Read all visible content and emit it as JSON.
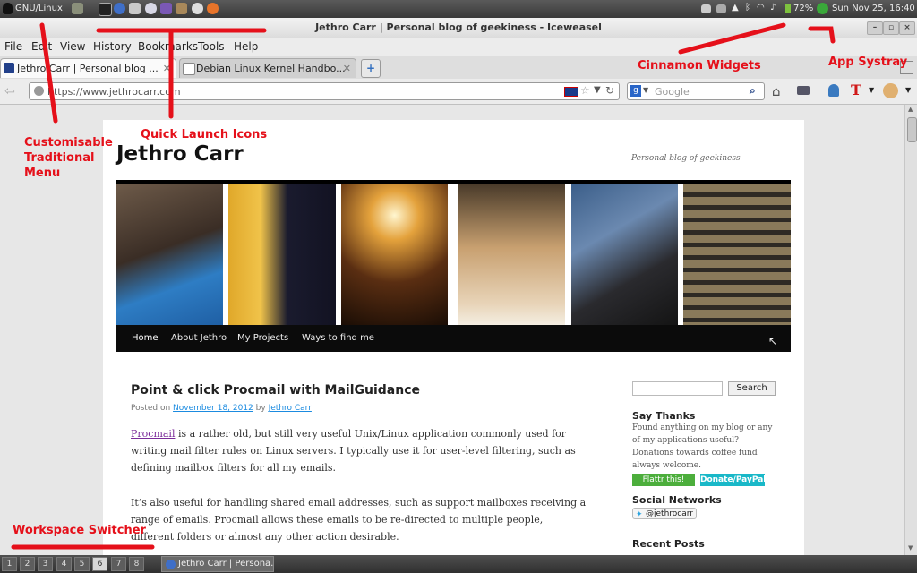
{
  "top_panel": {
    "menu_label": "GNU/Linux",
    "battery": "72%",
    "clock": "Sun Nov 25, 16:40",
    "quick_launch_icons": [
      "desktop-icon",
      "terminal-icon",
      "web-browser-icon",
      "mail-icon",
      "chat-icon",
      "media-player-icon",
      "files-icon",
      "settings-icon",
      "firefox-icon"
    ],
    "tray_icons": [
      "display-icon",
      "window-list-icon",
      "chevron-up-icon",
      "bluetooth-icon",
      "wifi-icon",
      "sound-icon",
      "battery-icon",
      "status-icon"
    ]
  },
  "window": {
    "title": "Jethro Carr | Personal blog of geekiness - Iceweasel"
  },
  "menubar": {
    "items": [
      "File",
      "Edit",
      "View",
      "History",
      "Bookmarks",
      "Tools",
      "Help"
    ]
  },
  "tabs": [
    {
      "label": "Jethro Carr | Personal blog ..."
    },
    {
      "label": "Debian Linux Kernel Handbo..."
    }
  ],
  "navbar": {
    "url": "https://www.jethrocarr.com",
    "search_placeholder": "Google"
  },
  "page": {
    "site_title": "Jethro Carr",
    "site_description": "Personal blog of geekiness",
    "nav": [
      "Home",
      "About Jethro",
      "My Projects",
      "Ways to find me"
    ],
    "post": {
      "title": "Point & click Procmail with MailGuidance",
      "meta_posted_on": "Posted on",
      "meta_date": "November 18, 2012",
      "meta_by": "by",
      "meta_author": "Jethro Carr",
      "p1_link": "Procmail",
      "p1_rest": " is a rather old, but still very useful Unix/Linux application commonly used for writing mail filter rules on Linux servers. I typically use it for user-level filtering, such as defining mailbox filters for all my emails.",
      "p2": "It’s also useful for handling shared email addresses, such as support mailboxes receiving a range of emails. Procmail allows these emails to be re-directed to multiple people, different folders or almost any other action desirable."
    },
    "sidebar": {
      "search_button": "Search",
      "say_thanks_title": "Say Thanks",
      "say_thanks_body": "Found anything on my blog or any of my applications useful? Donations towards coffee fund always welcome.",
      "flattr_label": "Flattr this!",
      "donate_label": "Donate/PayPal",
      "social_title": "Social Networks",
      "twitter_label": "@jethrocarr",
      "recent_posts_title": "Recent Posts"
    }
  },
  "annotations": {
    "menu": "Customisable Traditional Menu",
    "quick_launch": "Quick Launch Icons",
    "widgets": "Cinnamon Widgets",
    "systray": "App Systray",
    "workspace": "Workspace Switcher"
  },
  "bottom_panel": {
    "workspaces": [
      "1",
      "2",
      "3",
      "4",
      "5",
      "6",
      "7",
      "8"
    ],
    "active_workspace": "6",
    "task_label": "Jethro Carr | Persona..."
  },
  "colors": {
    "annotation": "#e5101a",
    "link": "#1b8be0",
    "visited_link": "#7b2b9a",
    "nav_bar": "#0b0b0b"
  }
}
